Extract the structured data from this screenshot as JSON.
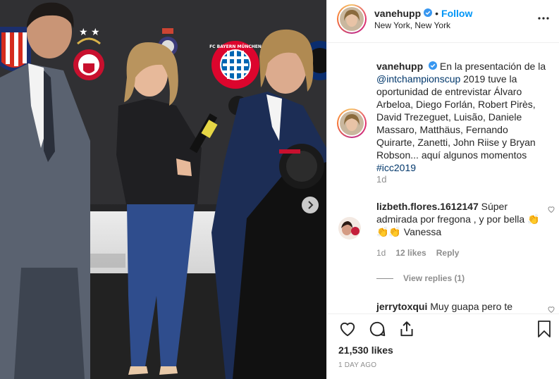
{
  "post": {
    "username": "vanehupp",
    "follow_label": "Follow",
    "dot": "•",
    "location": "New York, New York",
    "caption_pre": "En la presentación de la ",
    "caption_mention": "@intchampionscup",
    "caption_mid": " 2019 tuve la oportunidad de entrevistar Álvaro Arbeloa, Diego Forlán, Robert Pirès, David Trezeguet, Luisão, Daniele Massaro, Matthäus, Fernando Quirarte, Zanetti, John Riise y Bryan Robson... aquí algunos momentos ",
    "caption_hashtag": "#icc2019",
    "caption_time": "1d",
    "likes": "21,530 likes",
    "posted": "1 day ago"
  },
  "comments": [
    {
      "username": "lizbeth.flores.1612147",
      "text": "Súper admirada por fregona , y por bella",
      "emoji": "👏👏👏",
      "trailing": " Vanessa",
      "time": "1d",
      "likes": "12 likes",
      "reply_label": "Reply",
      "view_replies": "View replies (1)"
    },
    {
      "username": "jerrytoxqui",
      "text": "Muy guapa pero te"
    }
  ],
  "icons": {
    "verified": "verified-badge-icon",
    "more": "more-options-icon",
    "next": "chevron-right-icon",
    "like": "heart-icon",
    "comment": "comment-icon",
    "share": "share-icon",
    "save": "bookmark-icon"
  },
  "colors": {
    "accent": "#0095f6",
    "link": "#00376b",
    "muted": "#8e8e8e",
    "text": "#262626",
    "border": "#efefef"
  },
  "photo": {
    "logo_text": "FC BAYERN MÜNCHEN"
  }
}
